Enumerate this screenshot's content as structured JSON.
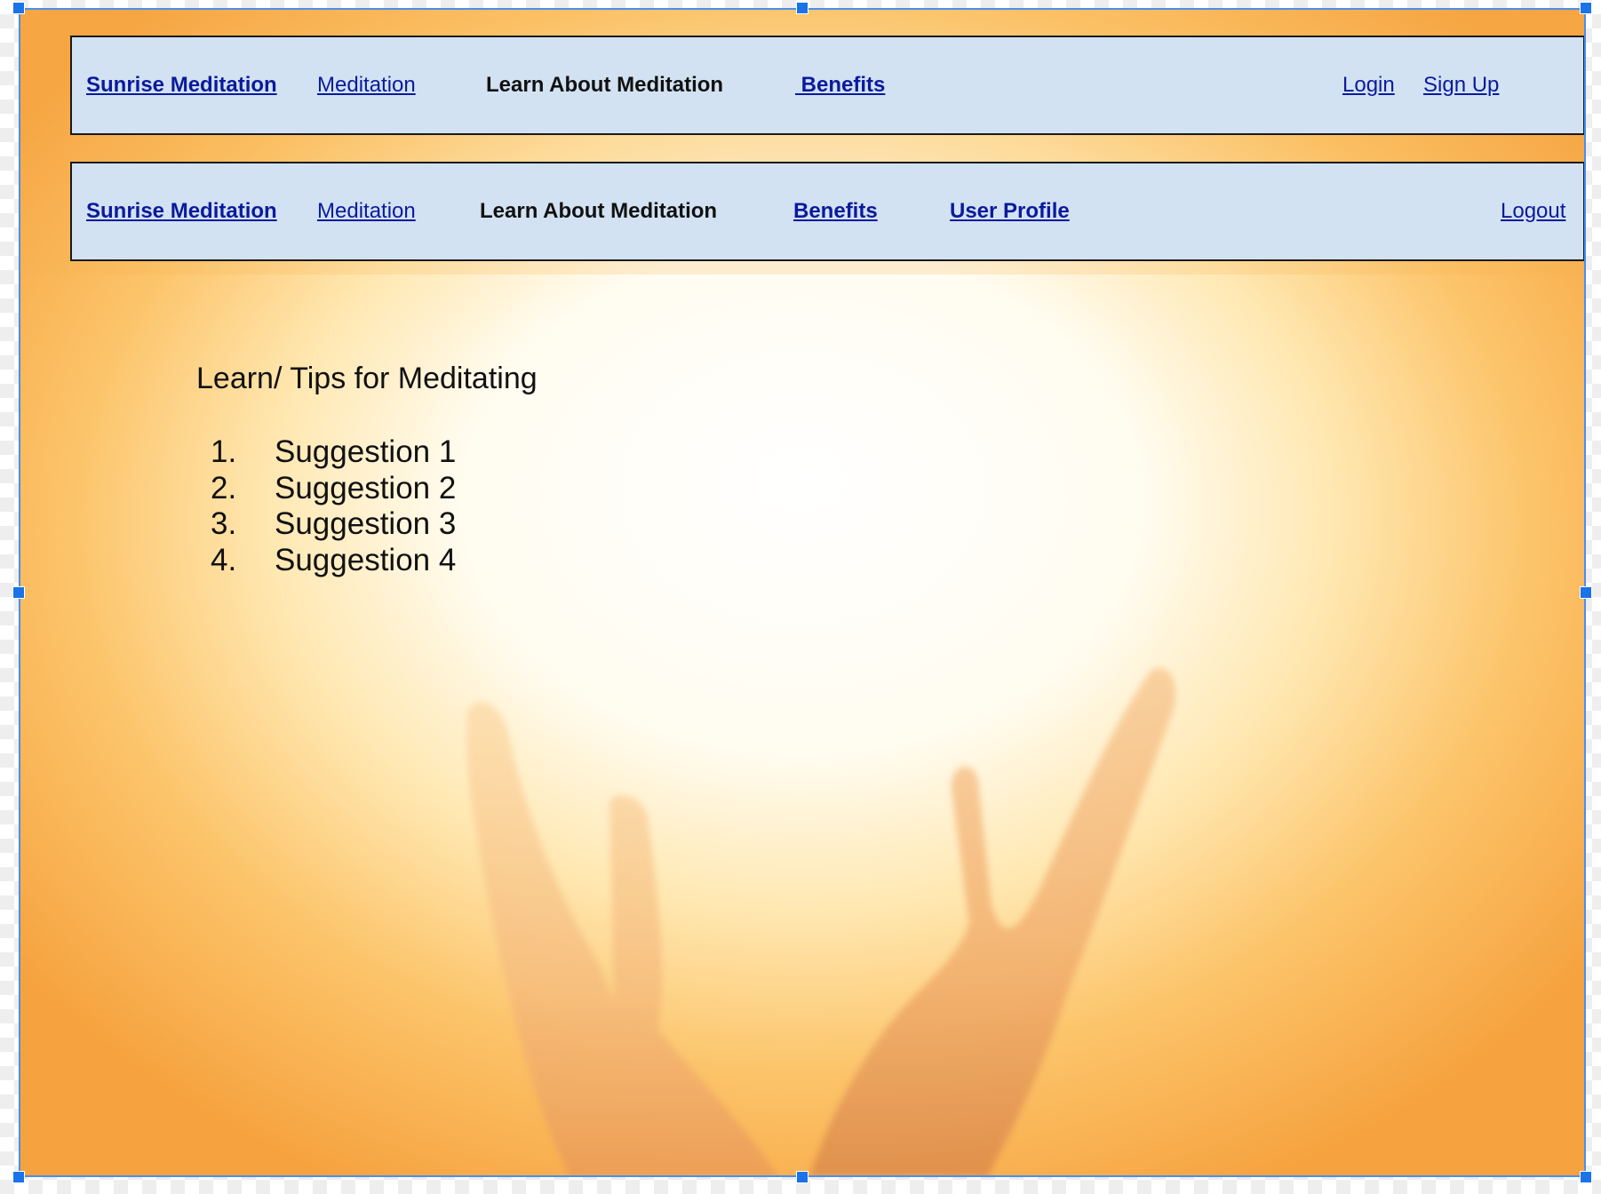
{
  "nav_logged_out": {
    "brand": "Sunrise Meditation",
    "meditation": "Meditation",
    "learn": "Learn About Meditation",
    "benefits": " Benefits",
    "login": "Login",
    "signup": "Sign Up"
  },
  "nav_logged_in": {
    "brand": "Sunrise Meditation",
    "meditation": "Meditation",
    "learn": "Learn About Meditation",
    "benefits": "Benefits",
    "profile": "User Profile",
    "logout": "Logout"
  },
  "content": {
    "title": "Learn/ Tips for Meditating",
    "tips": [
      {
        "num": "1.",
        "text": "Suggestion 1"
      },
      {
        "num": "2.",
        "text": "Suggestion 2"
      },
      {
        "num": "3.",
        "text": "Suggestion 3"
      },
      {
        "num": "4.",
        "text": "Suggestion 4"
      }
    ]
  },
  "colors": {
    "nav_bg": "#d2e2f2",
    "link": "#0b1a9c",
    "selection": "#1a73e8",
    "background_warm": "#f7a646",
    "background_glow": "#fffdf5"
  }
}
